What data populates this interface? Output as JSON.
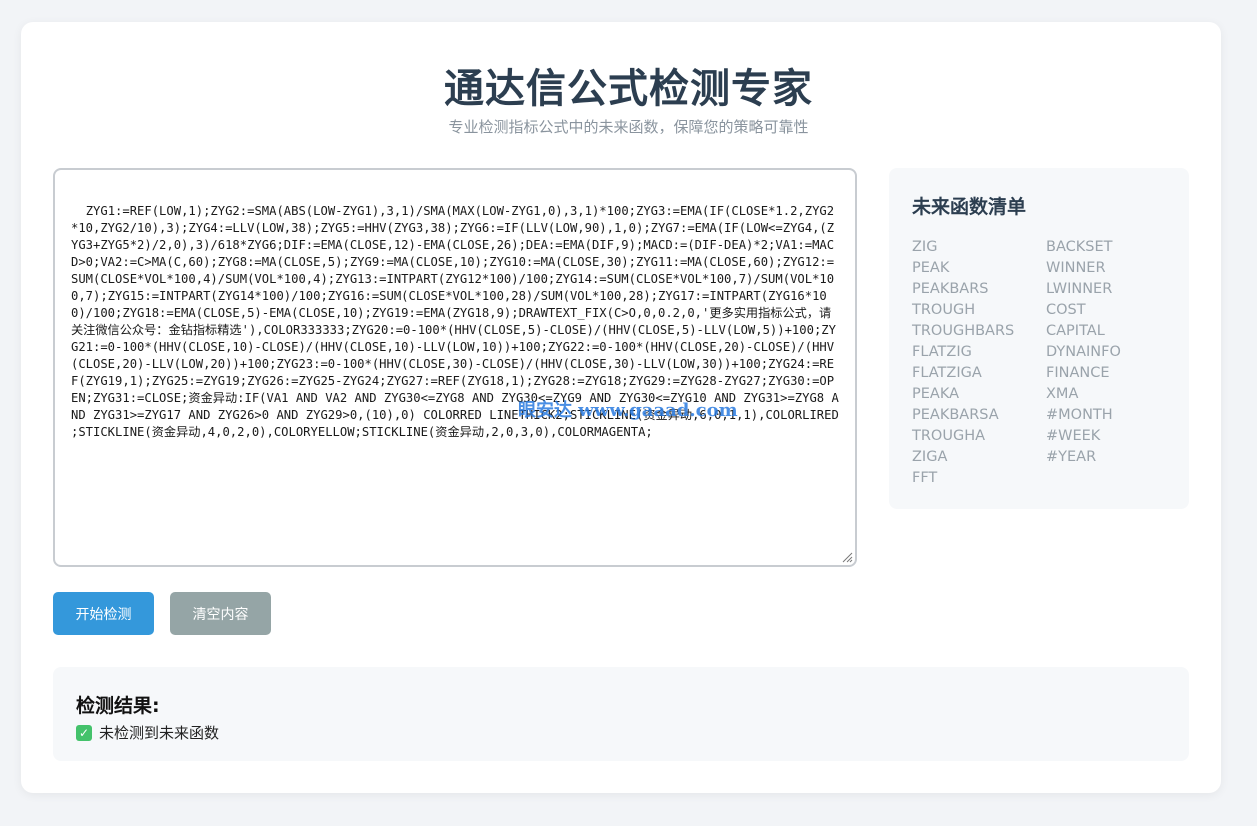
{
  "header": {
    "title": "通达信公式检测专家",
    "subtitle": "专业检测指标公式中的未来函数，保障您的策略可靠性"
  },
  "editor": {
    "content": "ZYG1:=REF(LOW,1);ZYG2:=SMA(ABS(LOW-ZYG1),3,1)/SMA(MAX(LOW-ZYG1,0),3,1)*100;ZYG3:=EMA(IF(CLOSE*1.2,ZYG2*10,ZYG2/10),3);ZYG4:=LLV(LOW,38);ZYG5:=HHV(ZYG3,38);ZYG6:=IF(LLV(LOW,90),1,0);ZYG7:=EMA(IF(LOW<=ZYG4,(ZYG3+ZYG5*2)/2,0),3)/618*ZYG6;DIF:=EMA(CLOSE,12)-EMA(CLOSE,26);DEA:=EMA(DIF,9);MACD:=(DIF-DEA)*2;VA1:=MACD>0;VA2:=C>MA(C,60);ZYG8:=MA(CLOSE,5);ZYG9:=MA(CLOSE,10);ZYG10:=MA(CLOSE,30);ZYG11:=MA(CLOSE,60);ZYG12:=SUM(CLOSE*VOL*100,4)/SUM(VOL*100,4);ZYG13:=INTPART(ZYG12*100)/100;ZYG14:=SUM(CLOSE*VOL*100,7)/SUM(VOL*100,7);ZYG15:=INTPART(ZYG14*100)/100;ZYG16:=SUM(CLOSE*VOL*100,28)/SUM(VOL*100,28);ZYG17:=INTPART(ZYG16*100)/100;ZYG18:=EMA(CLOSE,5)-EMA(CLOSE,10);ZYG19:=EMA(ZYG18,9);DRAWTEXT_FIX(C>O,0,0.2,0,'更多实用指标公式，请关注微信公众号：金钻指标精选'),COLOR333333;ZYG20:=0-100*(HHV(CLOSE,5)-CLOSE)/(HHV(CLOSE,5)-LLV(LOW,5))+100;ZYG21:=0-100*(HHV(CLOSE,10)-CLOSE)/(HHV(CLOSE,10)-LLV(LOW,10))+100;ZYG22:=0-100*(HHV(CLOSE,20)-CLOSE)/(HHV(CLOSE,20)-LLV(LOW,20))+100;ZYG23:=0-100*(HHV(CLOSE,30)-CLOSE)/(HHV(CLOSE,30)-LLV(LOW,30))+100;ZYG24:=REF(ZYG19,1);ZYG25:=ZYG19;ZYG26:=ZYG25-ZYG24;ZYG27:=REF(ZYG18,1);ZYG28:=ZYG18;ZYG29:=ZYG28-ZYG27;ZYG30:=OPEN;ZYG31:=CLOSE;资金异动:IF(VA1 AND VA2 AND ZYG30<=ZYG8 AND ZYG30<=ZYG9 AND ZYG30<=ZYG10 AND ZYG31>=ZYG8 AND ZYG31>=ZYG17 AND ZYG26>0 AND ZYG29>0,(10),0) COLORRED LINETHICK2;STICKLINE(资金异动,6,0,1,1),COLORLIRED ;STICKLINE(资金异动,4,0,2,0),COLORYELLOW;STICKLINE(资金异动,2,0,3,0),COLORMAGENTA;",
    "watermark": "眼安达 www.gaaad.com"
  },
  "panel": {
    "title": "未来函数清单",
    "functions": [
      "ZIG",
      "BACKSET",
      "PEAK",
      "WINNER",
      "PEAKBARS",
      "LWINNER",
      "TROUGH",
      "COST",
      "TROUGHBARS",
      "CAPITAL",
      "FLATZIG",
      "DYNAINFO",
      "FLATZIGA",
      "FINANCE",
      "PEAKA",
      "XMA",
      "PEAKBARSA",
      "#MONTH",
      "TROUGHA",
      "#WEEK",
      "ZIGA",
      "#YEAR",
      "FFT"
    ]
  },
  "buttons": {
    "start": "开始检测",
    "clear": "清空内容"
  },
  "result": {
    "title": "检测结果:",
    "message": "未检测到未来函数",
    "status_color": "#44c26b"
  }
}
